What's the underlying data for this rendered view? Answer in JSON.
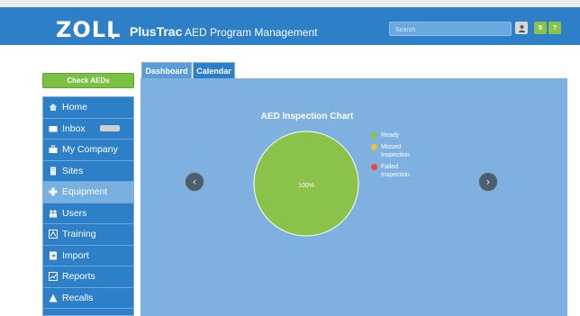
{
  "header": {
    "logo": "ZOLL",
    "product_bold": "PlusTrac",
    "product_rest": " AED Program Management",
    "search_placeholder": "Search",
    "user_icon": "user-icon",
    "green_btn_label": "0",
    "help_btn_label": "?"
  },
  "sidebar": {
    "check_button": "Check AEDs",
    "items": [
      {
        "label": "Home",
        "icon": "home-icon"
      },
      {
        "label": "Inbox",
        "icon": "inbox-icon"
      },
      {
        "label": "My Company",
        "icon": "briefcase-icon"
      },
      {
        "label": "Sites",
        "icon": "building-icon"
      },
      {
        "label": "Equipment",
        "icon": "equipment-icon"
      },
      {
        "label": "Users",
        "icon": "users-icon"
      },
      {
        "label": "Training",
        "icon": "training-icon"
      },
      {
        "label": "Import",
        "icon": "import-icon"
      },
      {
        "label": "Reports",
        "icon": "reports-icon"
      },
      {
        "label": "Recalls",
        "icon": "warning-icon"
      }
    ],
    "active": "Equipment"
  },
  "tabs": [
    {
      "label": "Dashboard"
    },
    {
      "label": "Calendar"
    }
  ],
  "chart_data": {
    "type": "pie",
    "title": "AED Inspection Chart",
    "categories": [
      "Ready",
      "Missed Inspection",
      "Failed Inspection"
    ],
    "values": [
      100,
      0,
      0
    ],
    "data_labels": [
      "100%"
    ],
    "colors": [
      "#8bc34a",
      "#f2c230",
      "#e8483c"
    ],
    "legend_position": "right"
  },
  "colors": {
    "brand_blue": "#2d7fc8",
    "panel_blue": "#7fb1e0",
    "accent_green": "#7ac143"
  }
}
